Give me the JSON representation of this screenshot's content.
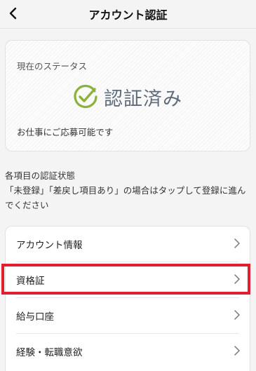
{
  "header": {
    "title": "アカウント認証",
    "back_icon": "chevron-left-icon"
  },
  "status_card": {
    "label": "現在のステータス",
    "status_text": "認証済み",
    "status_icon": "check-circle-icon",
    "icon_color": "#8bb23a",
    "note": "お仕事にご応募可能です"
  },
  "section": {
    "heading": "各項目の認証状態",
    "description": "「未登録」「差戻し項目あり」の場合はタップして登録に進んでください"
  },
  "items": [
    {
      "label": "アカウント情報",
      "icon": "chevron-right-icon"
    },
    {
      "label": "資格証",
      "icon": "chevron-right-icon",
      "highlighted": true
    },
    {
      "label": "給与口座",
      "icon": "chevron-right-icon"
    },
    {
      "label": "経験・転職意欲",
      "icon": "chevron-right-icon"
    }
  ],
  "colors": {
    "highlight": "#e0202e",
    "status_text": "#5f6b7a"
  }
}
